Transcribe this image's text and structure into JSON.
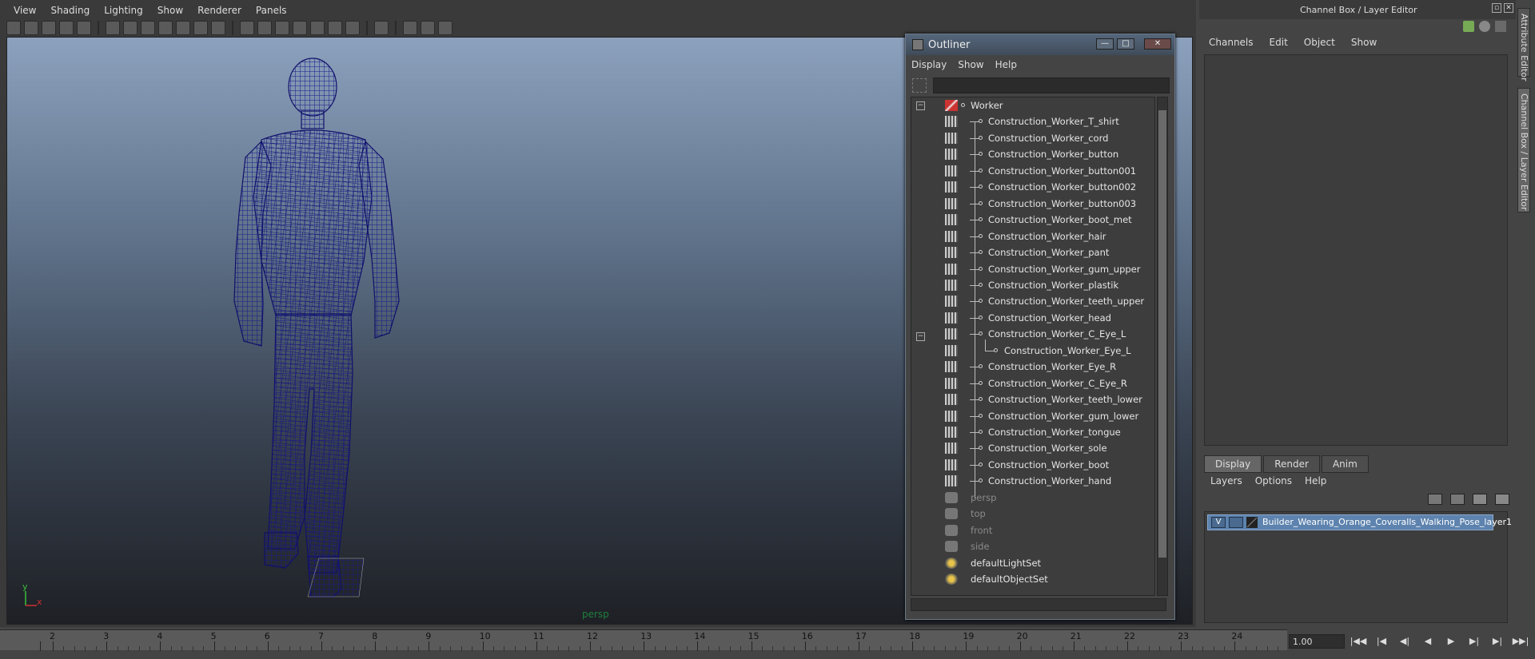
{
  "viewport": {
    "menu": [
      "View",
      "Shading",
      "Lighting",
      "Show",
      "Renderer",
      "Panels"
    ],
    "camera_label": "persp",
    "axis": {
      "x": "x",
      "y": "y"
    }
  },
  "outliner": {
    "title": "Outliner",
    "menu": [
      "Display",
      "Show",
      "Help"
    ],
    "search_value": "",
    "items": [
      {
        "label": "Worker",
        "type": "root"
      },
      {
        "label": "Construction_Worker_T_shirt",
        "type": "mesh"
      },
      {
        "label": "Construction_Worker_cord",
        "type": "mesh"
      },
      {
        "label": "Construction_Worker_button",
        "type": "mesh"
      },
      {
        "label": "Construction_Worker_button001",
        "type": "mesh"
      },
      {
        "label": "Construction_Worker_button002",
        "type": "mesh"
      },
      {
        "label": "Construction_Worker_button003",
        "type": "mesh"
      },
      {
        "label": "Construction_Worker_boot_met",
        "type": "mesh"
      },
      {
        "label": "Construction_Worker_hair",
        "type": "mesh"
      },
      {
        "label": "Construction_Worker_pant",
        "type": "mesh"
      },
      {
        "label": "Construction_Worker_gum_upper",
        "type": "mesh"
      },
      {
        "label": "Construction_Worker_plastik",
        "type": "mesh"
      },
      {
        "label": "Construction_Worker_teeth_upper",
        "type": "mesh"
      },
      {
        "label": "Construction_Worker_head",
        "type": "mesh"
      },
      {
        "label": "Construction_Worker_C_Eye_L",
        "type": "mesh-parent"
      },
      {
        "label": "Construction_Worker_Eye_L",
        "type": "mesh-child"
      },
      {
        "label": "Construction_Worker_Eye_R",
        "type": "mesh"
      },
      {
        "label": "Construction_Worker_C_Eye_R",
        "type": "mesh"
      },
      {
        "label": "Construction_Worker_teeth_lower",
        "type": "mesh"
      },
      {
        "label": "Construction_Worker_gum_lower",
        "type": "mesh"
      },
      {
        "label": "Construction_Worker_tongue",
        "type": "mesh"
      },
      {
        "label": "Construction_Worker_sole",
        "type": "mesh"
      },
      {
        "label": "Construction_Worker_boot",
        "type": "mesh"
      },
      {
        "label": "Construction_Worker_hand",
        "type": "mesh"
      },
      {
        "label": "persp",
        "type": "camera"
      },
      {
        "label": "top",
        "type": "camera"
      },
      {
        "label": "front",
        "type": "camera"
      },
      {
        "label": "side",
        "type": "camera"
      },
      {
        "label": "defaultLightSet",
        "type": "set"
      },
      {
        "label": "defaultObjectSet",
        "type": "set"
      }
    ]
  },
  "right_panel": {
    "title": "Channel Box / Layer Editor",
    "menu": [
      "Channels",
      "Edit",
      "Object",
      "Show"
    ],
    "tabs": [
      "Display",
      "Render",
      "Anim"
    ],
    "layer_menu": [
      "Layers",
      "Options",
      "Help"
    ],
    "layer": {
      "visible_flag": "V",
      "name": "Builder_Wearing_Orange_Coveralls_Walking_Pose_layer1"
    },
    "side_tabs": [
      "Attribute Editor",
      "Channel Box / Layer Editor"
    ]
  },
  "timeline": {
    "ticks": [
      "2",
      "3",
      "4",
      "5",
      "6",
      "7",
      "8",
      "9",
      "10",
      "11",
      "12",
      "13",
      "14",
      "15",
      "16",
      "17",
      "18",
      "19",
      "20",
      "21",
      "22",
      "23",
      "24"
    ],
    "current_frame": "1.00",
    "playback_buttons": [
      "|◀◀",
      "|◀",
      "◀|",
      "◀",
      "▶",
      "▶|",
      "▶|",
      "▶▶|"
    ]
  },
  "colors": {
    "mesh_wire": "#1a1a8a",
    "selection": "#5d83ae",
    "camera_label": "#1e7f3c"
  }
}
